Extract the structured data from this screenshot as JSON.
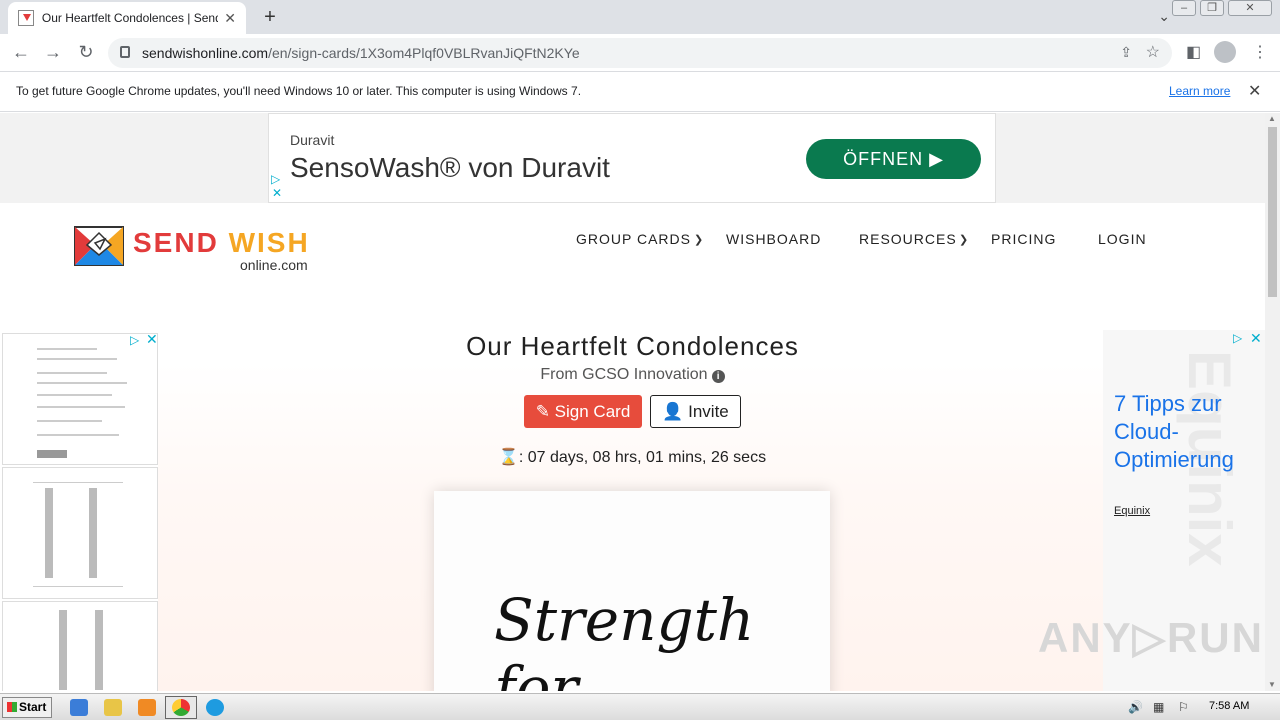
{
  "browser": {
    "tab_title": "Our Heartfelt Condolences | Sendwish",
    "tab_close": "✕",
    "new_tab": "+",
    "url_domain": "sendwishonline.com",
    "url_path": "/en/sign-cards/1X3om4Plqf0VBLRvanJiQFtN2KYe",
    "infobar_message": "To get future Google Chrome updates, you'll need Windows 10 or later. This computer is using Windows 7.",
    "infobar_link": "Learn more",
    "infobar_close": "✕"
  },
  "top_ad": {
    "brand": "Duravit",
    "headline": "SensoWash® von Duravit",
    "cta": "ÖFFNEN ▶",
    "choice": "▷",
    "close": "✕"
  },
  "site": {
    "logo_send": "SEND ",
    "logo_wish": "WISH",
    "logo_online": "online.com",
    "nav": {
      "group_cards": "GROUP CARDS",
      "wishboard": "WISHBOARD",
      "resources": "RESOURCES",
      "pricing": "PRICING",
      "login": "LOGIN"
    }
  },
  "card": {
    "title": "Our Heartfelt Condolences",
    "from": "From GCSO Innovation",
    "sign_button": "Sign Card",
    "invite_button": "Invite",
    "countdown": ": 07 days, 08 hrs, 01 mins, 26 secs",
    "preview_text": "Strength for"
  },
  "left_ad": {
    "choice": "▷",
    "close": "✕"
  },
  "right_ad": {
    "headline": "7 Tipps zur Cloud-Optimierung",
    "brand": "Equinix",
    "watermark": "Equinix",
    "choice": "▷",
    "close": "✕"
  },
  "watermark": "ANY▷RUN",
  "taskbar": {
    "start": "Start",
    "clock": "7:58 AM"
  },
  "colors": {
    "sign_button": "#e74c3c",
    "cta_green": "#0a7a4f",
    "logo_red": "#e23b3b",
    "logo_orange": "#f5a623",
    "ad_link_blue": "#1a73e8"
  }
}
